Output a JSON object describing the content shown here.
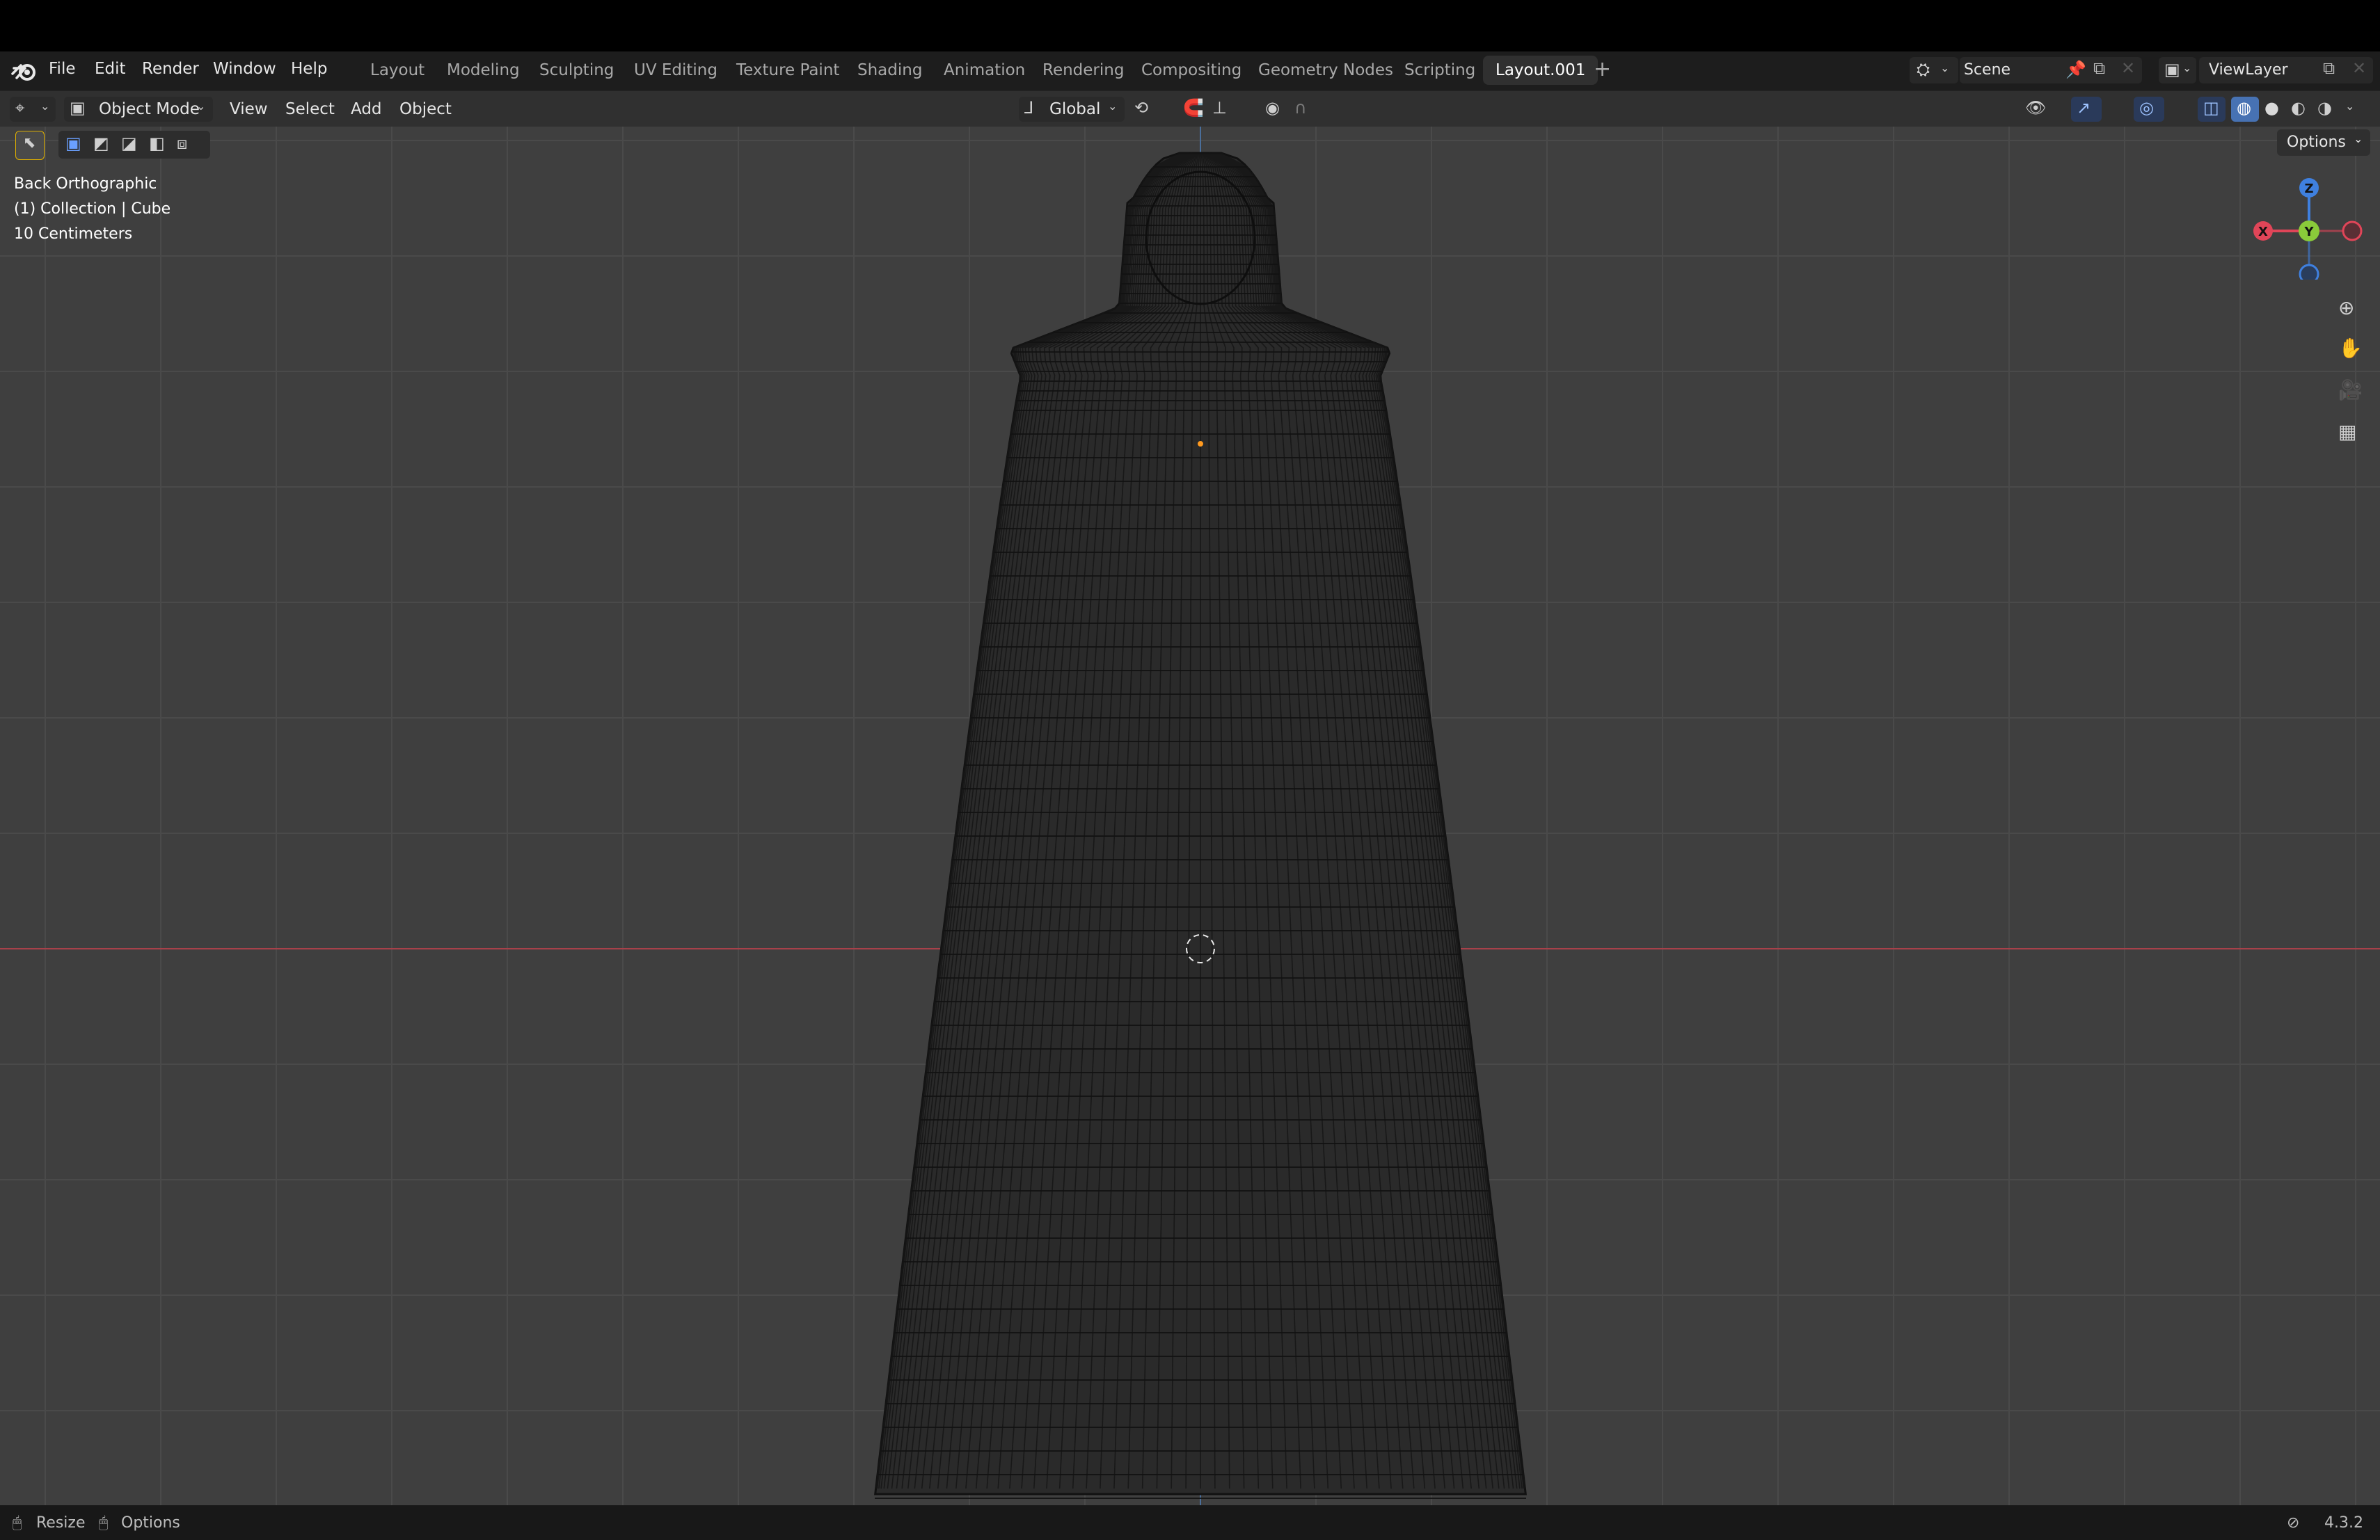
{
  "menubar": {
    "menus": [
      "File",
      "Edit",
      "Render",
      "Window",
      "Help"
    ],
    "workspaces": [
      "Layout",
      "Modeling",
      "Sculpting",
      "UV Editing",
      "Texture Paint",
      "Shading",
      "Animation",
      "Rendering",
      "Compositing",
      "Geometry Nodes",
      "Scripting",
      "Layout.001"
    ],
    "active_workspace": "Layout.001",
    "scene": "Scene",
    "view_layer": "ViewLayer"
  },
  "header": {
    "mode": "Object Mode",
    "menus": [
      "View",
      "Select",
      "Add",
      "Object"
    ],
    "transform_orientation": "Global",
    "options": "Options"
  },
  "viewport": {
    "view_name": "Back Orthographic",
    "collection": "(1) Collection | Cube",
    "scale": "10 Centimeters",
    "gizmo": {
      "z": "Z",
      "y": "Y",
      "x": "X"
    }
  },
  "statusbar": {
    "left": [
      "Resize",
      "Options"
    ],
    "version": "4.3.2"
  },
  "colors": {
    "viewport_bg": "#3f3f3f",
    "grid": "#4a4a4a",
    "x_axis": "#a8414a",
    "z_axis": "#4a6e9a",
    "gizmo_x": "#e04558",
    "gizmo_y": "#8acb3a",
    "gizmo_z": "#3f80df"
  }
}
